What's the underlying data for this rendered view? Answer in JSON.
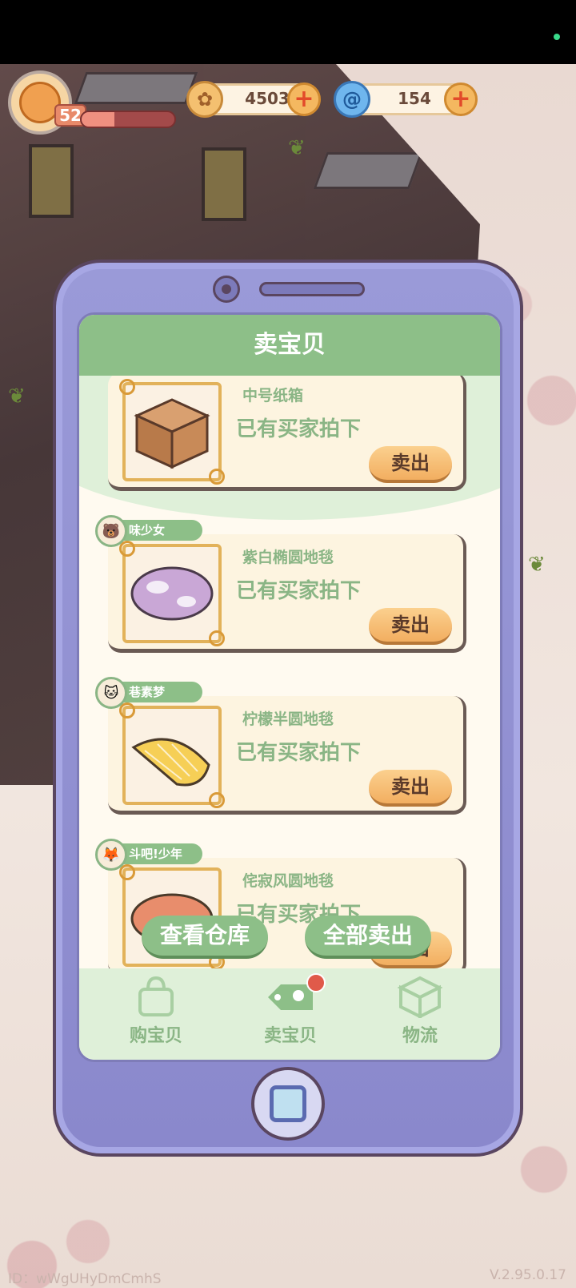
{
  "hud": {
    "level": "52",
    "xp_fraction": 0.35,
    "coins": "4503",
    "gems": "154"
  },
  "phone": {
    "title": "卖宝贝",
    "items": [
      {
        "name": "中号纸箱",
        "status": "已有买家拍下",
        "sell_label": "卖出",
        "buyer": ""
      },
      {
        "name": "紫白椭圆地毯",
        "status": "已有买家拍下",
        "sell_label": "卖出",
        "buyer": "味少女"
      },
      {
        "name": "柠檬半圆地毯",
        "status": "已有买家拍下",
        "sell_label": "卖出",
        "buyer": "巷素梦"
      },
      {
        "name": "侘寂风圆地毯",
        "status": "已有买家拍下",
        "sell_label": "卖出",
        "buyer": "斗吧!少年"
      }
    ],
    "actions": {
      "view_warehouse": "查看仓库",
      "sell_all": "全部卖出"
    },
    "tabs": [
      {
        "label": "购宝贝",
        "icon": "shopping-bag-icon"
      },
      {
        "label": "卖宝贝",
        "icon": "price-tag-icon"
      },
      {
        "label": "物流",
        "icon": "box-icon"
      }
    ]
  },
  "footer": {
    "id": "ID：wWgUHyDmCmhS",
    "version": "V.2.95.0.17"
  },
  "colors": {
    "accent_green": "#8dbf88",
    "phone_purple": "#9a9ad8",
    "sell_orange": "#f2ae60"
  }
}
